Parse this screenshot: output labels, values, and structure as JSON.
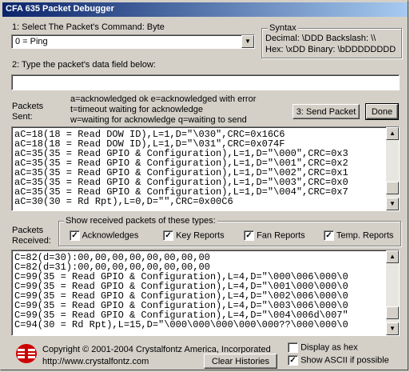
{
  "window": {
    "title": "CFA 635 Packet Debugger"
  },
  "command": {
    "label": "1: Select The Packet's Command: Byte",
    "selected": "0 = Ping"
  },
  "syntax": {
    "title": "Syntax",
    "line1": "Decimal: \\DDD Backslash: \\\\",
    "line2": "Hex: \\xDD Binary: \\bDDDDDDDD"
  },
  "data_field": {
    "label": "2: Type the packet's data field below:",
    "value": ""
  },
  "sent": {
    "label1": "Packets",
    "label2": "Sent:",
    "legend1": "a=acknowledged ok e=acknowledged with error",
    "legend2": "t=timeout waiting for acknowledge",
    "legend3": "w=waiting for acknowledge q=waiting to send",
    "send_button": "3: Send Packet",
    "done_button": "Done",
    "lines": [
      "aC=18(18 = Read DOW ID),L=1,D=\"\\030\",CRC=0x16C6",
      "aC=18(18 = Read DOW ID),L=1,D=\"\\031\",CRC=0x074F",
      "aC=35(35 = Read GPIO & Configuration),L=1,D=\"\\000\",CRC=0x3",
      "aC=35(35 = Read GPIO & Configuration),L=1,D=\"\\001\",CRC=0x2",
      "aC=35(35 = Read GPIO & Configuration),L=1,D=\"\\002\",CRC=0x1",
      "aC=35(35 = Read GPIO & Configuration),L=1,D=\"\\003\",CRC=0x0",
      "aC=35(35 = Read GPIO & Configuration),L=1,D=\"\\004\",CRC=0x7",
      "aC=30(30 = Rd Rpt),L=0,D=\"\",CRC=0x00C6"
    ]
  },
  "received": {
    "label1": "Packets",
    "label2": "Received:",
    "group_title": "Show received packets of these types:",
    "types": [
      {
        "label": "Acknowledges",
        "checked": "✓"
      },
      {
        "label": "Key Reports",
        "checked": "✓"
      },
      {
        "label": "Fan Reports",
        "checked": "✓"
      },
      {
        "label": "Temp. Reports",
        "checked": "✓"
      }
    ],
    "lines": [
      "C=82(d=30):00,00,00,00,00,00,00,00",
      "C=82(d=31):00,00,00,00,00,00,00,00",
      "C=99(35 = Read GPIO & Configuration),L=4,D=\"\\000\\006\\000\\0",
      "C=99(35 = Read GPIO & Configuration),L=4,D=\"\\001\\000\\000\\0",
      "C=99(35 = Read GPIO & Configuration),L=4,D=\"\\002\\006\\000\\0",
      "C=99(35 = Read GPIO & Configuration),L=4,D=\"\\003\\006\\000\\0",
      "C=99(35 = Read GPIO & Configuration),L=4,D=\"\\004\\006d\\007\"",
      "C=94(30 = Rd Rpt),L=15,D=\"\\000\\000\\000\\000\\000??\\000\\000\\0"
    ]
  },
  "footer": {
    "copyright": "Copyright © 2001-2004 Crystalfontz America, Incorporated",
    "url": "http://www.crystalfontz.com",
    "clear_button": "Clear Histories",
    "display_hex": "Display as hex",
    "display_hex_checked": "",
    "show_ascii": "Show ASCII if possible",
    "show_ascii_checked": "✓"
  },
  "colors": {
    "accent": "#0a246a",
    "logo": "#cc0000"
  }
}
